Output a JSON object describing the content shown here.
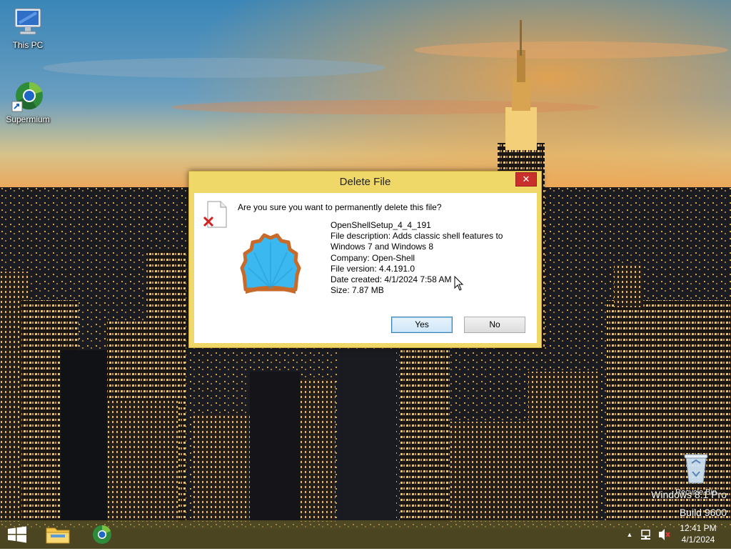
{
  "desktop": {
    "icons": [
      {
        "label": "This PC",
        "icon": "computer-icon"
      },
      {
        "label": "Supermium",
        "icon": "browser-icon"
      },
      {
        "label": "Recycle Bin",
        "icon": "recycle-bin-icon"
      }
    ],
    "watermark": {
      "line1": "Windows 8.1 Pro",
      "line2": "Build 9600"
    }
  },
  "dialog": {
    "title": "Delete File",
    "close_label": "✕",
    "question": "Are you sure you want to permanently delete this file?",
    "file": {
      "name": "OpenShellSetup_4_4_191",
      "description_line1": "File description: Adds classic shell features to",
      "description_line2": "Windows 7 and Windows 8",
      "company": "Company: Open-Shell",
      "version": "File version: 4.4.191.0",
      "date_created": "Date created: 4/1/2024 7:58 AM",
      "size": "Size: 7.87 MB"
    },
    "yes_label": "Yes",
    "no_label": "No",
    "colors": {
      "frame": "#f0d868",
      "close": "#c9302c"
    }
  },
  "taskbar": {
    "items": [
      {
        "name": "start",
        "icon": "windows-logo-icon"
      },
      {
        "name": "file-explorer",
        "icon": "folder-icon"
      },
      {
        "name": "supermium",
        "icon": "browser-icon"
      }
    ],
    "tray": {
      "chevron": "▲",
      "network_icon": "network-icon",
      "volume_icon": "volume-muted-icon"
    },
    "clock": {
      "time": "12:41 PM",
      "date": "4/1/2024"
    }
  }
}
